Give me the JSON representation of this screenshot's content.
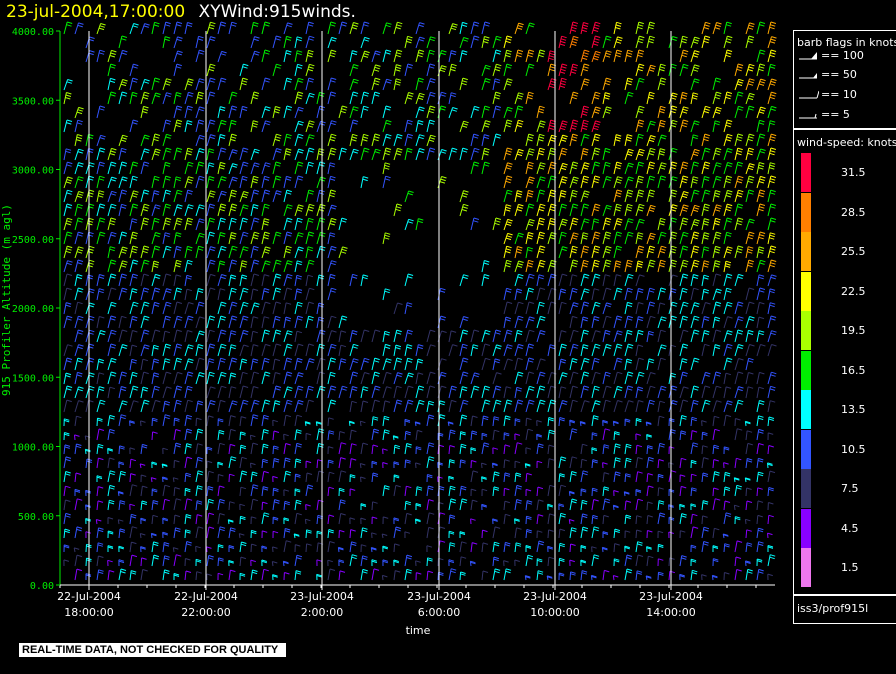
{
  "header": {
    "timestamp": "23-jul-2004,17:00:00",
    "title": "XYWind:915winds."
  },
  "chart_data": {
    "type": "wind-barb time-height",
    "ylabel": "915 Profiler Altitude (m agl)",
    "xlabel": "time",
    "ylim": [
      0,
      4000
    ],
    "yticks": [
      "4000.00",
      "3500.00",
      "3000.00",
      "2500.00",
      "2000.00",
      "1500.00",
      "1000.00",
      "500.00",
      "0.00"
    ],
    "xticks": [
      {
        "date": "22-Jul-2004",
        "time": "18:00:00"
      },
      {
        "date": "22-Jul-2004",
        "time": "22:00:00"
      },
      {
        "date": "23-Jul-2004",
        "time": "2:00:00"
      },
      {
        "date": "23-Jul-2004",
        "time": "6:00:00"
      },
      {
        "date": "23-Jul-2004",
        "time": "10:00:00"
      },
      {
        "date": "23-Jul-2004",
        "time": "14:00:00"
      }
    ],
    "grid": true
  },
  "legend": {
    "barb_title": "barb flags in knots",
    "barbs": [
      "== 100",
      "== 50",
      "== 10",
      "== 5"
    ],
    "speed_title": "wind-speed: knots",
    "speed_scale": [
      {
        "label": "31.5",
        "color": "#ff0040"
      },
      {
        "label": "28.5",
        "color": "#ff7f00"
      },
      {
        "label": "25.5",
        "color": "#ffaa00"
      },
      {
        "label": "22.5",
        "color": "#ffff00"
      },
      {
        "label": "19.5",
        "color": "#aaff00"
      },
      {
        "label": "16.5",
        "color": "#00ee00"
      },
      {
        "label": "13.5",
        "color": "#00ffff"
      },
      {
        "label": "10.5",
        "color": "#3355ff"
      },
      {
        "label": "7.5",
        "color": "#333366"
      },
      {
        "label": "4.5",
        "color": "#8800ff"
      },
      {
        "label": "1.5",
        "color": "#ee77ee"
      }
    ],
    "source": "iss3/prof915l"
  },
  "footer": {
    "notice": "REAL-TIME DATA, NOT CHECKED FOR QUALITY"
  }
}
